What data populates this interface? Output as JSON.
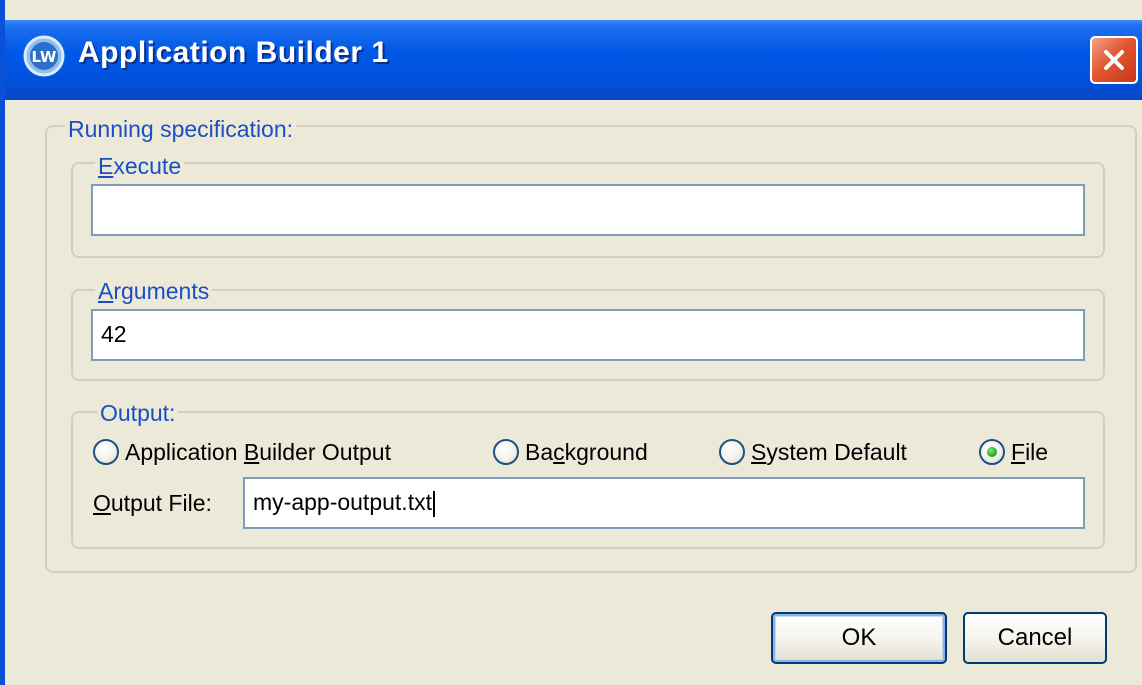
{
  "window": {
    "title": "Application Builder 1",
    "close_icon": "close-icon",
    "app_icon": "app-icon"
  },
  "running_spec": {
    "legend": "Running specification:",
    "execute": {
      "legend_mnemonic": "E",
      "legend_rest": "xecute",
      "value": ""
    },
    "arguments": {
      "legend_mnemonic": "A",
      "legend_rest": "rguments",
      "value": "42"
    },
    "output": {
      "legend": "Output:",
      "options": [
        {
          "pre": "Application ",
          "mnemonic": "B",
          "post": "uilder Output",
          "checked": false
        },
        {
          "pre": "Ba",
          "mnemonic": "c",
          "post": "kground",
          "checked": false
        },
        {
          "pre": "",
          "mnemonic": "S",
          "post": "ystem Default",
          "checked": false
        },
        {
          "pre": "",
          "mnemonic": "F",
          "post": "ile",
          "checked": true
        }
      ],
      "output_file_label_mnemonic": "O",
      "output_file_label_rest": "utput File:",
      "output_file_value": "my-app-output.txt"
    }
  },
  "buttons": {
    "ok": "OK",
    "cancel": "Cancel"
  },
  "colors": {
    "titlebar": "#0058e6",
    "dialog_bg": "#ece9d8",
    "legend_text": "#1a4fc4",
    "close_btn": "#e2572f"
  }
}
